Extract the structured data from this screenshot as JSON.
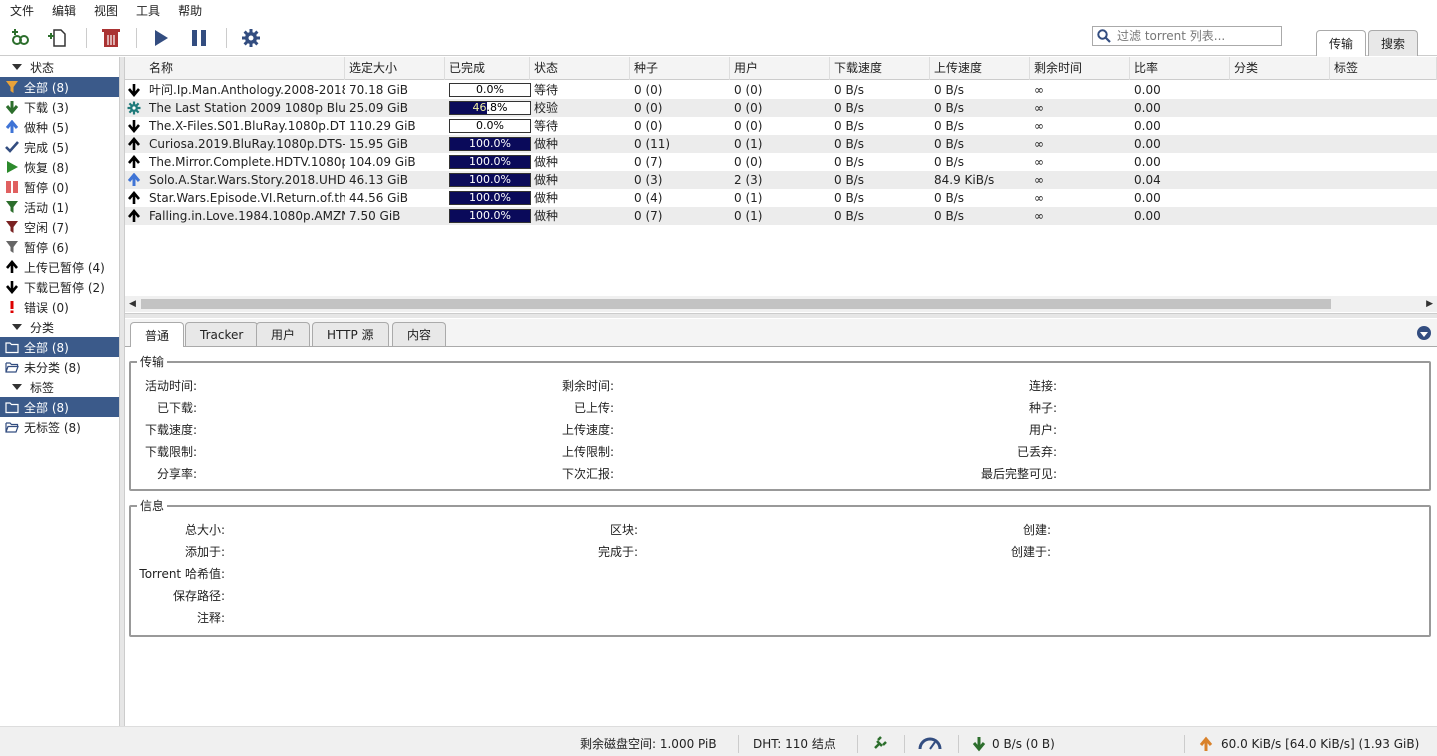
{
  "menu": [
    "文件",
    "编辑",
    "视图",
    "工具",
    "帮助"
  ],
  "search": {
    "placeholder": "过滤 torrent 列表..."
  },
  "view_tabs": [
    "传输",
    "搜索"
  ],
  "sidebar": {
    "status_header": "状态",
    "status_items": [
      {
        "label": "全部 (8)",
        "icon": "filter-orange-icon",
        "selected": true
      },
      {
        "label": "下载 (3)",
        "icon": "arrow-down-green-icon"
      },
      {
        "label": "做种 (5)",
        "icon": "arrow-up-blue-icon"
      },
      {
        "label": "完成 (5)",
        "icon": "check-icon"
      },
      {
        "label": "恢复 (8)",
        "icon": "play-green-icon"
      },
      {
        "label": "暂停 (0)",
        "icon": "pause-red-icon"
      },
      {
        "label": "活动 (1)",
        "icon": "filter-green-icon"
      },
      {
        "label": "空闲 (7)",
        "icon": "filter-red-icon"
      },
      {
        "label": "暂停 (6)",
        "icon": "filter-gray-icon"
      },
      {
        "label": "上传已暂停 (4)",
        "icon": "arrow-up-black-icon"
      },
      {
        "label": "下载已暂停 (2)",
        "icon": "arrow-down-black-icon"
      },
      {
        "label": "错误 (0)",
        "icon": "error-icon"
      }
    ],
    "category_header": "分类",
    "category_items": [
      {
        "label": "全部 (8)",
        "icon": "folder-icon",
        "selected": true
      },
      {
        "label": "未分类 (8)",
        "icon": "folder-open-icon"
      }
    ],
    "tag_header": "标签",
    "tag_items": [
      {
        "label": "全部 (8)",
        "icon": "folder-icon",
        "selected": true
      },
      {
        "label": "无标签 (8)",
        "icon": "folder-open-icon"
      }
    ]
  },
  "columns": [
    "名称",
    "选定大小",
    "已完成",
    "状态",
    "种子",
    "用户",
    "下载速度",
    "上传速度",
    "剩余时间",
    "比率",
    "分类",
    "标签"
  ],
  "torrents": [
    {
      "icon": "arrow-down-black-icon",
      "name": "叶问.Ip.Man.Anthology.2008-2018....",
      "size": "70.18 GiB",
      "progress": 0.0,
      "progress_text": "0.0%",
      "state": "等待",
      "seeds": "0 (0)",
      "peers": "0 (0)",
      "dl": "0 B/s",
      "ul": "0 B/s",
      "eta": "∞",
      "ratio": "0.00"
    },
    {
      "icon": "gear-teal-icon",
      "name": "The Last Station 2009 1080p Blu-r...",
      "size": "25.09 GiB",
      "progress": 0.468,
      "progress_text": "46.8%",
      "state": "校验",
      "seeds": "0 (0)",
      "peers": "0 (0)",
      "dl": "0 B/s",
      "ul": "0 B/s",
      "eta": "∞",
      "ratio": "0.00"
    },
    {
      "icon": "arrow-down-black-icon",
      "name": "The.X-Files.S01.BluRay.1080p.DT...",
      "size": "110.29 GiB",
      "progress": 0.0,
      "progress_text": "0.0%",
      "state": "等待",
      "seeds": "0 (0)",
      "peers": "0 (0)",
      "dl": "0 B/s",
      "ul": "0 B/s",
      "eta": "∞",
      "ratio": "0.00"
    },
    {
      "icon": "arrow-up-black-icon",
      "name": "Curiosa.2019.BluRay.1080p.DTS-...",
      "size": "15.95 GiB",
      "progress": 1.0,
      "progress_text": "100.0%",
      "state": "做种",
      "seeds": "0 (11)",
      "peers": "0 (1)",
      "dl": "0 B/s",
      "ul": "0 B/s",
      "eta": "∞",
      "ratio": "0.00"
    },
    {
      "icon": "arrow-up-black-icon",
      "name": "The.Mirror.Complete.HDTV.1080p...",
      "size": "104.09 GiB",
      "progress": 1.0,
      "progress_text": "100.0%",
      "state": "做种",
      "seeds": "0 (7)",
      "peers": "0 (0)",
      "dl": "0 B/s",
      "ul": "0 B/s",
      "eta": "∞",
      "ratio": "0.00"
    },
    {
      "icon": "arrow-up-blue-icon",
      "name": "Solo.A.Star.Wars.Story.2018.UHD...",
      "size": "46.13 GiB",
      "progress": 1.0,
      "progress_text": "100.0%",
      "state": "做种",
      "seeds": "0 (3)",
      "peers": "2 (3)",
      "dl": "0 B/s",
      "ul": "84.9 KiB/s",
      "eta": "∞",
      "ratio": "0.04"
    },
    {
      "icon": "arrow-up-black-icon",
      "name": "Star.Wars.Episode.VI.Return.of.th...",
      "size": "44.56 GiB",
      "progress": 1.0,
      "progress_text": "100.0%",
      "state": "做种",
      "seeds": "0 (4)",
      "peers": "0 (1)",
      "dl": "0 B/s",
      "ul": "0 B/s",
      "eta": "∞",
      "ratio": "0.00"
    },
    {
      "icon": "arrow-up-black-icon",
      "name": "Falling.in.Love.1984.1080p.AMZN...",
      "size": "7.50 GiB",
      "progress": 1.0,
      "progress_text": "100.0%",
      "state": "做种",
      "seeds": "0 (7)",
      "peers": "0 (1)",
      "dl": "0 B/s",
      "ul": "0 B/s",
      "eta": "∞",
      "ratio": "0.00"
    }
  ],
  "detail_tabs": [
    "普通",
    "Tracker",
    "用户",
    "HTTP 源",
    "内容"
  ],
  "transfer": {
    "legend": "传输",
    "col1": [
      "活动时间:",
      "已下载:",
      "下载速度:",
      "下载限制:",
      "分享率:"
    ],
    "col2": [
      "剩余时间:",
      "已上传:",
      "上传速度:",
      "上传限制:",
      "下次汇报:"
    ],
    "col3": [
      "连接:",
      "种子:",
      "用户:",
      "已丢弃:",
      "最后完整可见:"
    ]
  },
  "info": {
    "legend": "信息",
    "col1": [
      "总大小:",
      "添加于:",
      "Torrent 哈希值:",
      "保存路径:",
      "注释:"
    ],
    "col2": [
      "区块:",
      "完成于:"
    ],
    "col3": [
      "创建:",
      "创建于:"
    ]
  },
  "status": {
    "disk": "剩余磁盘空间: 1.000 PiB",
    "dht": "DHT: 110 结点",
    "download": "0 B/s (0 B)",
    "upload": "60.0 KiB/s [64.0 KiB/s] (1.93 GiB)"
  },
  "colors": {
    "selection": "#3b5a8a",
    "progress_fill": "#0a0a5a",
    "accent": "#334d80"
  }
}
